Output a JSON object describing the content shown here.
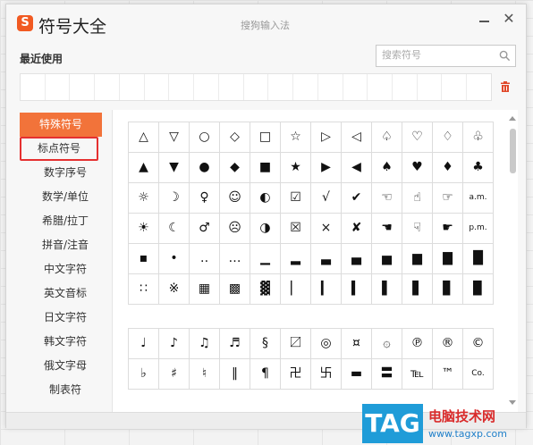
{
  "app": {
    "logo_glyph": "S",
    "title": "符号大全",
    "caption": "搜狗输入法",
    "close_glyph": "✕"
  },
  "recent": {
    "label": "最近使用"
  },
  "search": {
    "placeholder": "搜索符号"
  },
  "sidebar": {
    "items": [
      {
        "label": "特殊符号"
      },
      {
        "label": "标点符号"
      },
      {
        "label": "数字序号"
      },
      {
        "label": "数学/单位"
      },
      {
        "label": "希腊/拉丁"
      },
      {
        "label": "拼音/注音"
      },
      {
        "label": "中文字符"
      },
      {
        "label": "英文音标"
      },
      {
        "label": "日文字符"
      },
      {
        "label": "韩文字符"
      },
      {
        "label": "俄文字母"
      },
      {
        "label": "制表符"
      }
    ]
  },
  "symbols_top": [
    [
      "△",
      "▽",
      "○",
      "◇",
      "□",
      "☆",
      "▷",
      "◁",
      "♤",
      "♡",
      "♢",
      "♧"
    ],
    [
      "▲",
      "▼",
      "●",
      "◆",
      "■",
      "★",
      "▶",
      "◀",
      "♠",
      "♥",
      "♦",
      "♣"
    ],
    [
      "☼",
      "☽",
      "♀",
      "☺",
      "◐",
      "☑",
      "√",
      "✔",
      "☜",
      "☝",
      "☞",
      "a.m."
    ],
    [
      "☀",
      "☾",
      "♂",
      "☹",
      "◑",
      "☒",
      "×",
      "✘",
      "☚",
      "☟",
      "☛",
      "p.m."
    ],
    [
      "▪",
      "•",
      "‥",
      "…",
      "▁",
      "▂",
      "▃",
      "▄",
      "▅",
      "▆",
      "▇",
      "█"
    ],
    [
      "∷",
      "※",
      "▦",
      "▩",
      "▓",
      "▏",
      "▎",
      "▍",
      "▌",
      "▋",
      "▊",
      "▉"
    ]
  ],
  "symbols_bottom": [
    [
      "♩",
      "♪",
      "♫",
      "♬",
      "§",
      "〼",
      "◎",
      "¤",
      "۞",
      "℗",
      "®",
      "©"
    ],
    [
      "♭",
      "♯",
      "♮",
      "‖",
      "¶",
      "卍",
      "卐",
      "▬",
      "〓",
      "℡",
      "™",
      "Co."
    ]
  ],
  "colors": {
    "accent": "#f2733a",
    "highlight_outline": "#e53030",
    "watermark_blue": "#1f9cd8",
    "watermark_red": "#d92b2b"
  },
  "watermark": {
    "tag": "TAG",
    "title": "电脑技术网",
    "url": "www.tagxp.com"
  }
}
